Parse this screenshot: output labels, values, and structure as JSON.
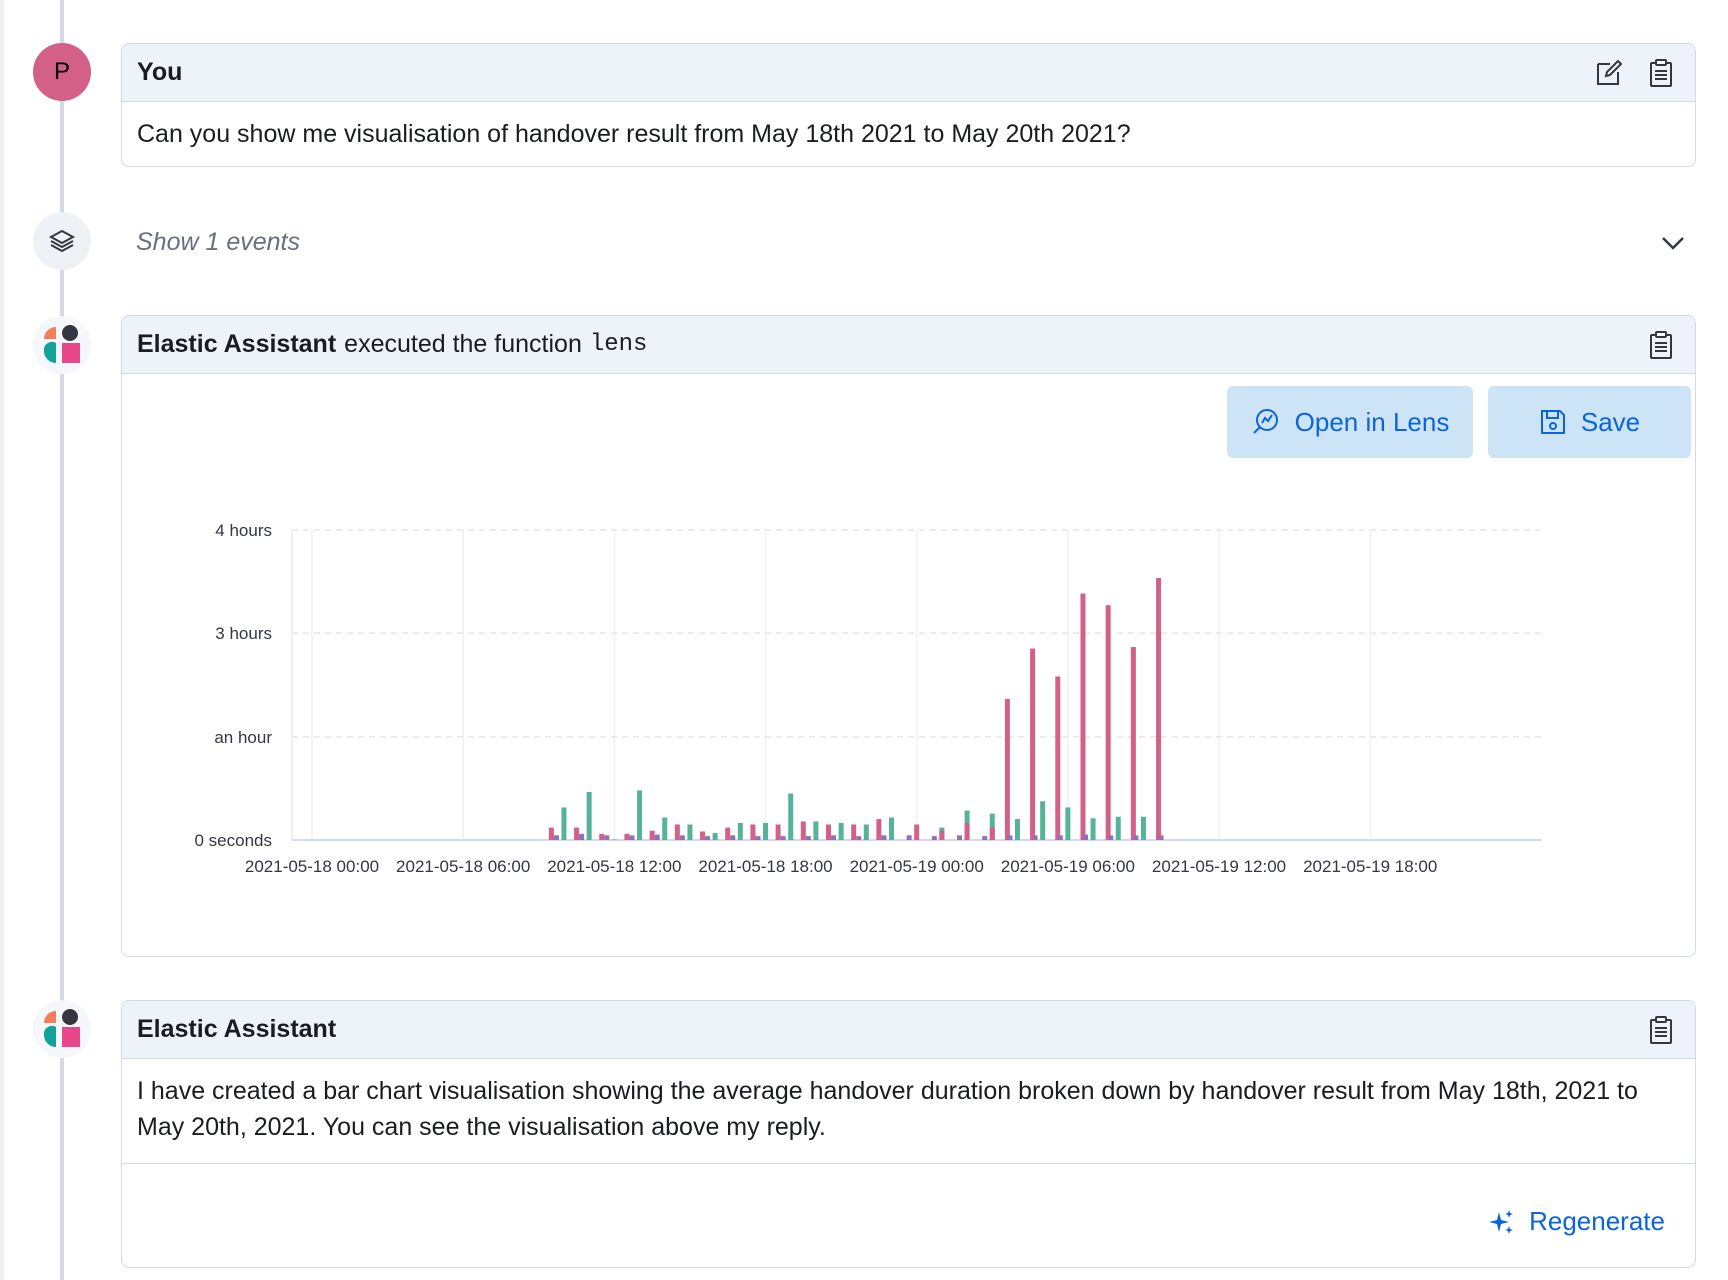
{
  "colors": {
    "accent": "#0b64dd",
    "avatar_user": "#d36086",
    "series_green": "#54b399",
    "series_pink": "#d36086",
    "series_purple": "#9170b8"
  },
  "user_message": {
    "avatar_letter": "P",
    "author": "You",
    "text": "Can you show me visualisation of handover result from May 18th 2021 to May 20th 2021?",
    "icons": [
      "edit-icon",
      "copy-clipboard-icon"
    ]
  },
  "events": {
    "label": "Show 1 events",
    "icon": "layers-icon",
    "toggle_icon": "chevron-down-icon"
  },
  "function_message": {
    "author": "Elastic Assistant",
    "action_text": "executed the function",
    "function_name": "lens",
    "open_lens_label": "Open in Lens",
    "save_label": "Save"
  },
  "assistant_message": {
    "author": "Elastic Assistant",
    "text": "I have created a bar chart visualisation showing the average handover duration broken down by handover result from May 18th, 2021 to May 20th, 2021. You can see the visualisation above my reply.",
    "regenerate_label": "Regenerate"
  },
  "chart_data": {
    "type": "bar",
    "y_tick_labels": [
      "0 seconds",
      "an hour",
      "3 hours",
      "4 hours"
    ],
    "y_tick_values": [
      0,
      1.33,
      2.67,
      4
    ],
    "ylim": [
      0,
      4
    ],
    "x_tick_labels": [
      "2021-05-18 00:00",
      "2021-05-18 06:00",
      "2021-05-18 12:00",
      "2021-05-18 18:00",
      "2021-05-19 00:00",
      "2021-05-19 06:00",
      "2021-05-19 12:00",
      "2021-05-19 18:00"
    ],
    "x_range_hours": [
      0,
      48
    ],
    "grid": true,
    "series": [
      {
        "color": "#54b399",
        "points": [
          [
            9.5,
            0.06
          ],
          [
            10.0,
            0.42
          ],
          [
            11.0,
            0.62
          ],
          [
            12.0,
            0.0
          ],
          [
            13.0,
            0.64
          ],
          [
            14.0,
            0.29
          ],
          [
            15.0,
            0.2
          ],
          [
            16.0,
            0.09
          ],
          [
            17.0,
            0.22
          ],
          [
            18.0,
            0.22
          ],
          [
            19.0,
            0.6
          ],
          [
            20.0,
            0.24
          ],
          [
            21.0,
            0.22
          ],
          [
            22.0,
            0.2
          ],
          [
            23.0,
            0.29
          ],
          [
            25.0,
            0.16
          ],
          [
            26.0,
            0.38
          ],
          [
            27.0,
            0.34
          ],
          [
            28.0,
            0.27
          ],
          [
            29.0,
            0.5
          ],
          [
            30.0,
            0.42
          ],
          [
            31.0,
            0.28
          ],
          [
            32.0,
            0.3
          ],
          [
            33.0,
            0.3
          ]
        ]
      },
      {
        "color": "#d36086",
        "points": [
          [
            9.5,
            0.16
          ],
          [
            10.5,
            0.16
          ],
          [
            11.5,
            0.08
          ],
          [
            12.5,
            0.08
          ],
          [
            13.5,
            0.12
          ],
          [
            14.5,
            0.2
          ],
          [
            15.5,
            0.11
          ],
          [
            16.5,
            0.16
          ],
          [
            17.5,
            0.2
          ],
          [
            18.5,
            0.2
          ],
          [
            19.5,
            0.24
          ],
          [
            20.5,
            0.2
          ],
          [
            21.5,
            0.2
          ],
          [
            22.5,
            0.27
          ],
          [
            24.0,
            0.2
          ],
          [
            25.0,
            0.12
          ],
          [
            26.0,
            0.22
          ],
          [
            27.0,
            0.16
          ],
          [
            27.6,
            1.82
          ],
          [
            28.6,
            2.47
          ],
          [
            29.6,
            2.11
          ],
          [
            30.6,
            3.18
          ],
          [
            31.6,
            3.03
          ],
          [
            32.6,
            2.49
          ],
          [
            33.6,
            3.38
          ]
        ]
      },
      {
        "color": "#9170b8",
        "points": [
          [
            9.7,
            0.06
          ],
          [
            10.7,
            0.08
          ],
          [
            11.7,
            0.06
          ],
          [
            12.7,
            0.06
          ],
          [
            13.7,
            0.07
          ],
          [
            14.7,
            0.06
          ],
          [
            15.7,
            0.05
          ],
          [
            16.7,
            0.06
          ],
          [
            17.7,
            0.05
          ],
          [
            18.7,
            0.05
          ],
          [
            19.7,
            0.05
          ],
          [
            20.7,
            0.06
          ],
          [
            21.7,
            0.05
          ],
          [
            22.7,
            0.06
          ],
          [
            23.7,
            0.06
          ],
          [
            24.7,
            0.05
          ],
          [
            25.7,
            0.06
          ],
          [
            26.7,
            0.05
          ],
          [
            27.7,
            0.06
          ],
          [
            28.7,
            0.06
          ],
          [
            29.7,
            0.06
          ],
          [
            30.7,
            0.07
          ],
          [
            31.7,
            0.06
          ],
          [
            32.7,
            0.06
          ],
          [
            33.7,
            0.06
          ]
        ]
      }
    ]
  }
}
